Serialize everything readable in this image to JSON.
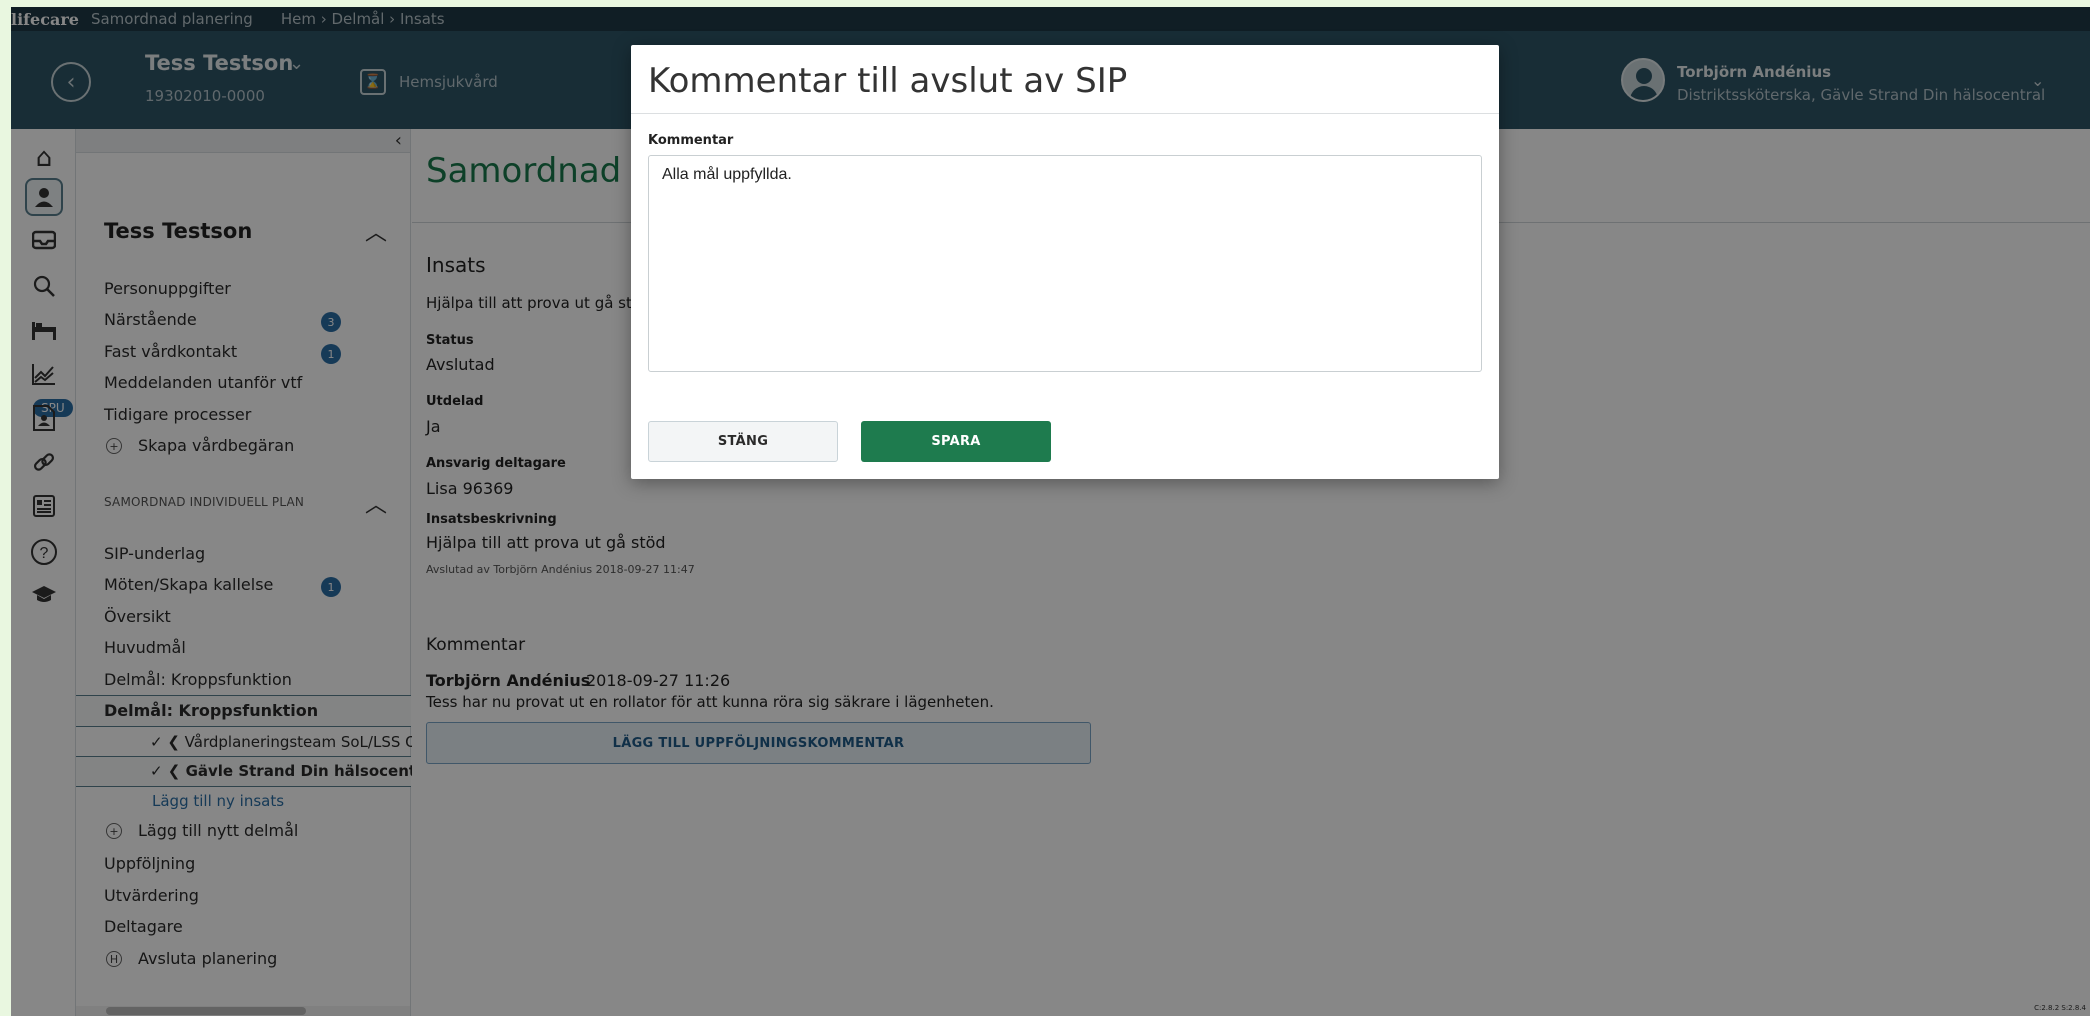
{
  "topbar": {
    "logo": "lifecare",
    "app_name": "Samordnad planering",
    "breadcrumb": "Hem › Delmål › Insats"
  },
  "header": {
    "patient_name": "Tess Testson",
    "patient_id": "19302010-0000",
    "unit": "Hemsjukvård",
    "user_name": "Torbjörn Andénius",
    "user_role": "Distriktssköterska, Gävle Strand Din hälsocentral"
  },
  "rail": {
    "icons": [
      "home-icon",
      "person-icon",
      "inbox-icon",
      "search-icon",
      "bed-icon",
      "chart-icon",
      "document-icon",
      "link-icon",
      "news-icon",
      "help-icon",
      "graduation-icon"
    ],
    "spu_badge": "SPU"
  },
  "sidenav": {
    "title": "Tess Testson",
    "items": [
      {
        "label": "Personuppgifter"
      },
      {
        "label": "Närstående",
        "badge": "3"
      },
      {
        "label": "Fast vårdkontakt",
        "badge": "1"
      },
      {
        "label": "Meddelanden utanför vtf"
      },
      {
        "label": "Tidigare processer"
      },
      {
        "label": "Skapa vårdbegäran"
      }
    ],
    "section_title": "SAMORDNAD INDIVIDUELL PLAN",
    "sip_items": [
      {
        "label": "SIP-underlag"
      },
      {
        "label": "Möten/Skapa kallelse",
        "badge": "1"
      },
      {
        "label": "Översikt"
      },
      {
        "label": "Huvudmål"
      },
      {
        "label": "Delmål: Kroppsfunktion"
      },
      {
        "label": "Delmål: Kroppsfunktion"
      },
      {
        "label": "✓ ❮ Vårdplaneringsteam SoL/LSS Om"
      },
      {
        "label": "✓ ❮ Gävle Strand Din hälsocentral"
      },
      {
        "label": "Lägg till ny insats"
      },
      {
        "label": "Lägg till nytt delmål"
      },
      {
        "label": "Uppföljning"
      },
      {
        "label": "Utvärdering"
      },
      {
        "label": "Deltagare"
      },
      {
        "label": "Avsluta planering"
      }
    ]
  },
  "main": {
    "title": "Samordnad individuell plan",
    "section": "Insats",
    "description": "Hjälpa till att prova ut gå stöd",
    "status_label": "Status",
    "status_value": "Avslutad",
    "assigned_label": "Utdelad",
    "assigned_value": "Ja",
    "responsible_label": "Ansvarig deltagare",
    "responsible_value": "Lisa 96369",
    "desc_label": "Insatsbeskrivning",
    "desc_value": "Hjälpa till att prova ut gå stöd",
    "closed_by": "Avslutad av Torbjörn Andénius 2018-09-27 11:47",
    "comment_header": "Kommentar",
    "comment_author": "Torbjörn Andénius",
    "comment_date": "2018-09-27 11:26",
    "comment_text": "Tess har nu provat ut en rollator för att kunna röra sig säkrare i lägenheten.",
    "add_followup": "LÄGG TILL UPPFÖLJNINGSKOMMENTAR",
    "version": "C:2.8.2 S:2.8.4"
  },
  "modal": {
    "title": "Kommentar till avslut av SIP",
    "field_label": "Kommentar",
    "field_value": "Alla mål uppfyllda.",
    "close_label": "STÄNG",
    "save_label": "SPARA"
  },
  "colors": {
    "header_bg": "#2e5566",
    "topstrip_bg": "#1f3a47",
    "accent_green": "#1e7b4e",
    "badge_blue": "#2b6ea5",
    "title_green": "#1a7a4c"
  }
}
